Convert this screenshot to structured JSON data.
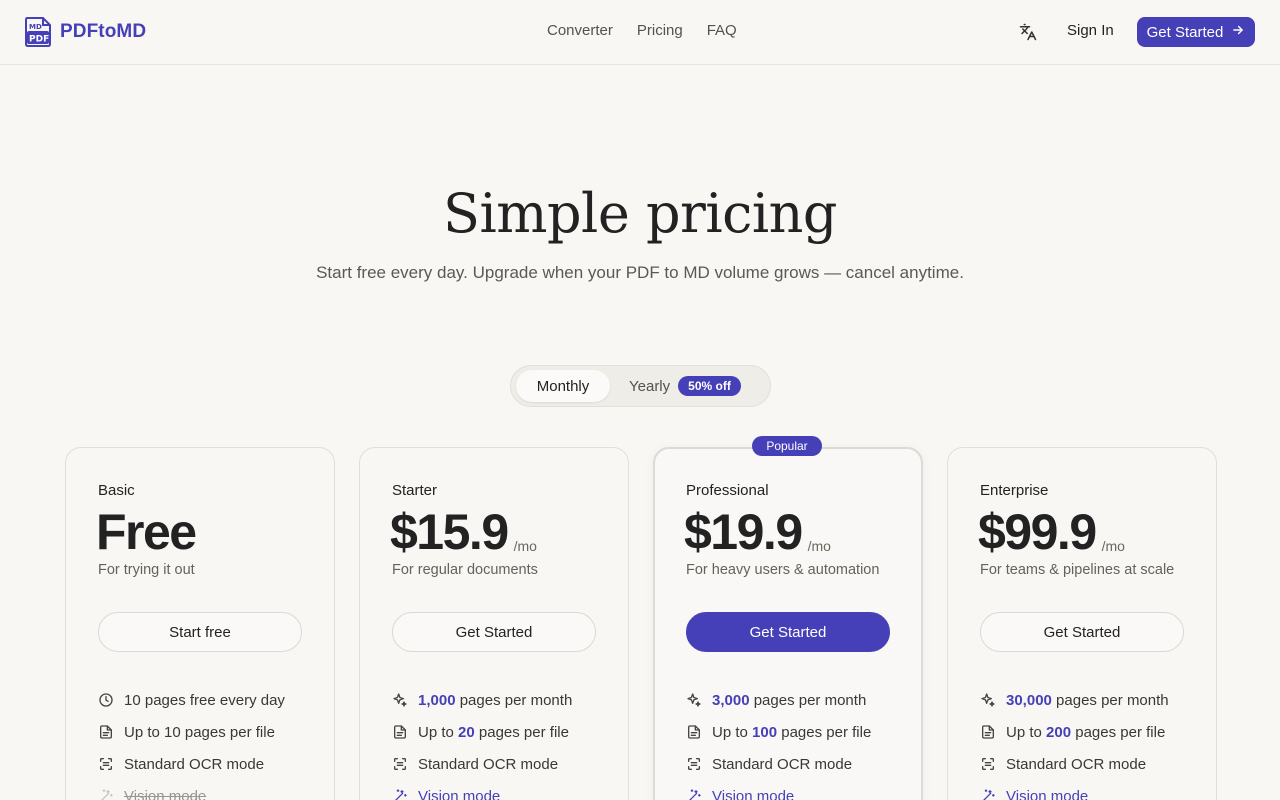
{
  "brand": {
    "name": "PDFtoMD",
    "logo_text_top": "MD",
    "logo_text_bottom": "PDF",
    "color": "#4640b8"
  },
  "nav": {
    "links": [
      "Converter",
      "Pricing",
      "FAQ"
    ],
    "translate_icon": "translate-icon",
    "sign_in": "Sign In",
    "cta": "Get Started"
  },
  "hero": {
    "title": "Simple pricing",
    "subtitle": "Start free every day. Upgrade when your PDF to MD volume grows — cancel anytime."
  },
  "billing_toggle": {
    "monthly": "Monthly",
    "yearly": "Yearly",
    "discount_badge": "50% off",
    "selected": "Monthly"
  },
  "popular_badge": "Popular",
  "plans": [
    {
      "name": "Basic",
      "price": "Free",
      "period": "",
      "description": "For trying it out",
      "button": "Start free",
      "features": [
        {
          "icon": "clock-icon",
          "pre": "",
          "value": "",
          "text": "10 pages free every day"
        },
        {
          "icon": "document-icon",
          "pre": "",
          "value": "",
          "text": "Up to 10 pages per file"
        },
        {
          "icon": "scan-icon",
          "pre": "",
          "value": "",
          "text": "Standard OCR mode"
        },
        {
          "icon": "magic-wand-icon",
          "pre": "",
          "value": "",
          "text": "Vision mode",
          "disabled": true
        }
      ]
    },
    {
      "name": "Starter",
      "price": "$15.9",
      "period": "/mo",
      "description": "For regular documents",
      "button": "Get Started",
      "features": [
        {
          "icon": "sparkle-icon",
          "pre": "",
          "value": "1,000",
          "text": " pages per month"
        },
        {
          "icon": "document-icon",
          "pre": "Up to ",
          "value": "20",
          "text": " pages per file"
        },
        {
          "icon": "scan-icon",
          "pre": "",
          "value": "",
          "text": "Standard OCR mode"
        },
        {
          "icon": "magic-wand-icon",
          "pre": "",
          "value": "",
          "text": "Vision mode",
          "link": true
        }
      ]
    },
    {
      "name": "Professional",
      "price": "$19.9",
      "period": "/mo",
      "description": "For heavy users & automation",
      "button": "Get Started",
      "featured": true,
      "features": [
        {
          "icon": "sparkle-icon",
          "pre": "",
          "value": "3,000",
          "text": " pages per month"
        },
        {
          "icon": "document-icon",
          "pre": "Up to ",
          "value": "100",
          "text": " pages per file"
        },
        {
          "icon": "scan-icon",
          "pre": "",
          "value": "",
          "text": "Standard OCR mode"
        },
        {
          "icon": "magic-wand-icon",
          "pre": "",
          "value": "",
          "text": "Vision mode",
          "link": true
        }
      ]
    },
    {
      "name": "Enterprise",
      "price": "$99.9",
      "period": "/mo",
      "description": "For teams & pipelines at scale",
      "button": "Get Started",
      "features": [
        {
          "icon": "sparkle-icon",
          "pre": "",
          "value": "30,000",
          "text": " pages per month"
        },
        {
          "icon": "document-icon",
          "pre": "Up to ",
          "value": "200",
          "text": " pages per file"
        },
        {
          "icon": "scan-icon",
          "pre": "",
          "value": "",
          "text": "Standard OCR mode"
        },
        {
          "icon": "magic-wand-icon",
          "pre": "",
          "value": "",
          "text": "Vision mode",
          "link": true
        }
      ]
    }
  ]
}
